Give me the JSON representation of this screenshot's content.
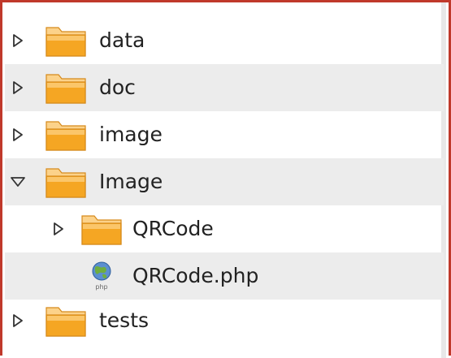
{
  "tree": {
    "items": [
      {
        "label": "data",
        "type": "folder",
        "expander": "collapsed",
        "depth": 0
      },
      {
        "label": "doc",
        "type": "folder",
        "expander": "collapsed",
        "depth": 0
      },
      {
        "label": "image",
        "type": "folder",
        "expander": "collapsed",
        "depth": 0
      },
      {
        "label": "Image",
        "type": "folder",
        "expander": "expanded",
        "depth": 0
      },
      {
        "label": "QRCode",
        "type": "folder",
        "expander": "collapsed",
        "depth": 1
      },
      {
        "label": "QRCode.php",
        "type": "php-file",
        "expander": "none",
        "depth": 1,
        "icon_text": "php"
      },
      {
        "label": "tests",
        "type": "folder",
        "expander": "collapsed",
        "depth": 0
      }
    ]
  },
  "colors": {
    "border": "#c0392b",
    "folder_front": "#f5a623",
    "folder_back": "#fcd28a",
    "row_alt": "#ececec"
  }
}
